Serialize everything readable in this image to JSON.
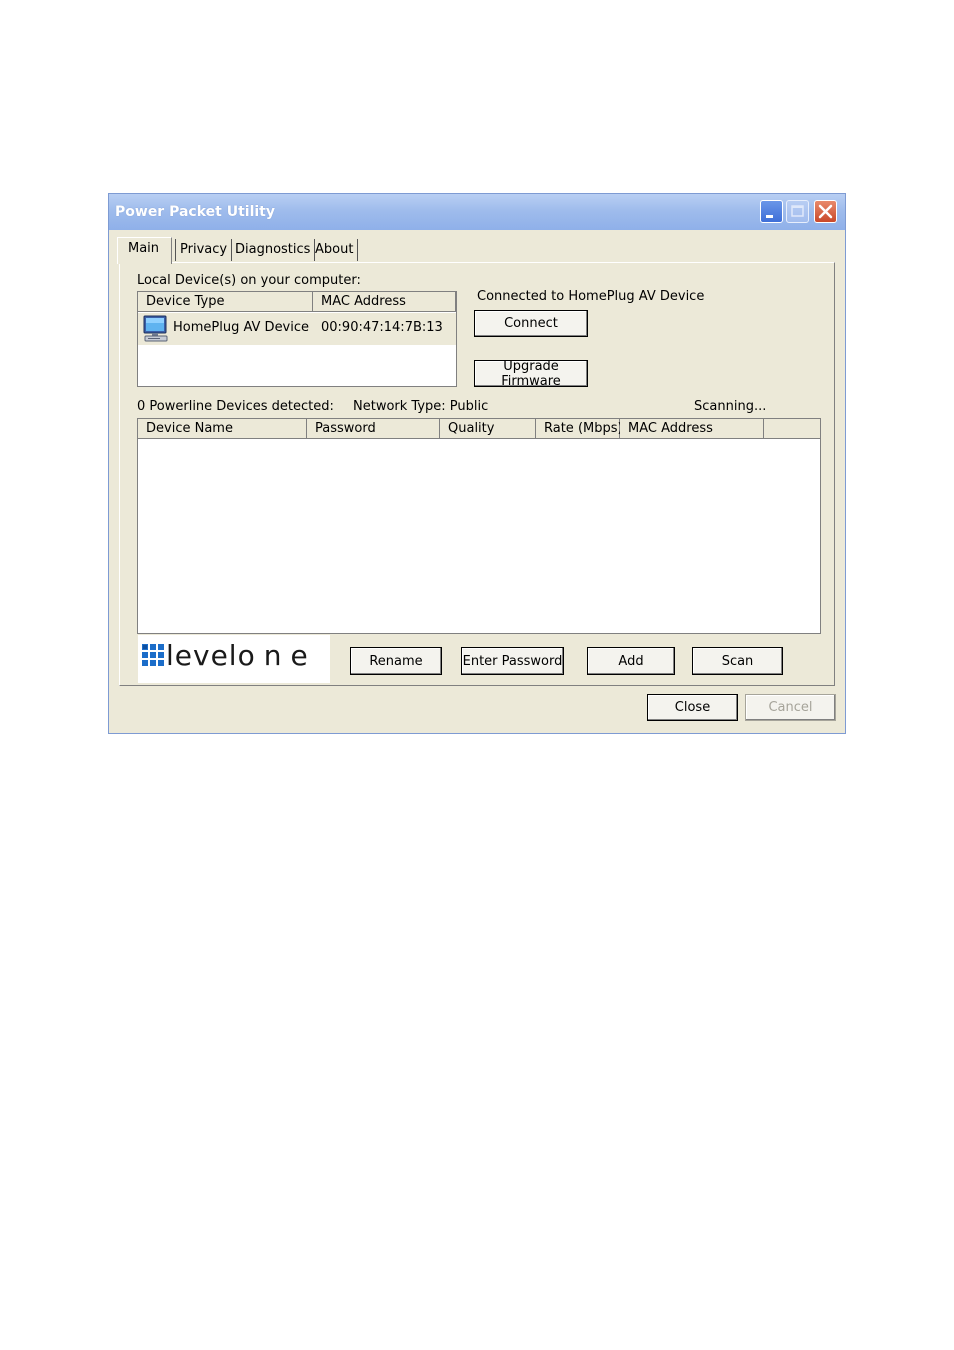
{
  "window": {
    "title": "Power Packet Utility",
    "title_buttons": [
      "minimize",
      "maximize",
      "close"
    ]
  },
  "tabs": [
    {
      "label": "Main",
      "active": true
    },
    {
      "label": "Privacy",
      "active": false
    },
    {
      "label": "Diagnostics",
      "active": false
    },
    {
      "label": "About",
      "active": false
    }
  ],
  "local": {
    "label": "Local Device(s) on your computer:",
    "columns": [
      "Device Type",
      "MAC Address"
    ],
    "rows": [
      {
        "icon": "computer-icon",
        "type": "HomePlug AV Device",
        "mac": "00:90:47:14:7B:13"
      }
    ]
  },
  "connection": {
    "status": "Connected to HomePlug AV Device",
    "connect_label": "Connect",
    "upgrade_label": "Upgrade Firmware"
  },
  "powerline": {
    "detected": "0 Powerline Devices detected:",
    "network_type": "Network Type: Public",
    "scan_status": "Scanning...",
    "columns": [
      "Device Name",
      "Password",
      "Quality",
      "Rate (Mbps)",
      "MAC Address"
    ]
  },
  "logo": {
    "bold_part": "level",
    "light_part": "one"
  },
  "actions": {
    "rename": "Rename",
    "enter_password": "Enter Password",
    "add": "Add",
    "scan": "Scan"
  },
  "footer": {
    "close": "Close",
    "cancel": "Cancel"
  }
}
